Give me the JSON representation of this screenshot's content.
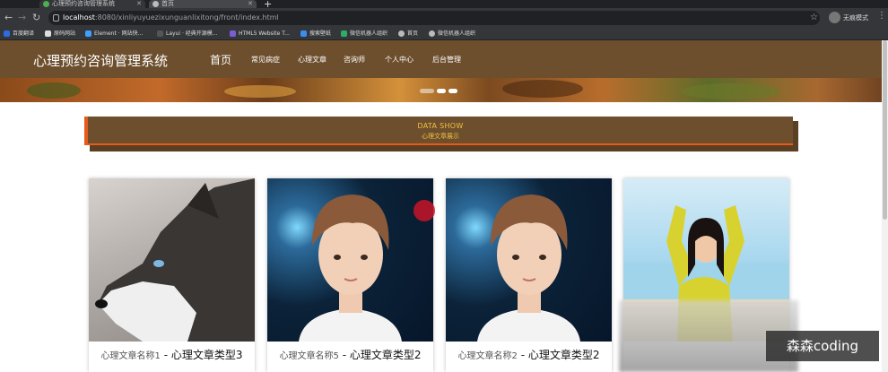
{
  "browser": {
    "tabs": [
      {
        "title": "心理预约咨询管理系统"
      },
      {
        "title": "首页"
      }
    ],
    "url_host": "localhost",
    "url_path": ":8080/xinliyuyuezixunguanlixitong/front/index.html",
    "profile_label": "无痕模式",
    "bookmarks": [
      "百度翻译",
      "原码网站",
      "Element · 网站快...",
      "Layui · 经典开源模...",
      "HTML5 Website T...",
      "搜索壁纸",
      "微信机器人组织",
      "首页",
      "微信机器人组织"
    ]
  },
  "site": {
    "title": "心理预约咨询管理系统",
    "nav": [
      "首页",
      "常见病症",
      "心理文章",
      "咨询师",
      "个人中心",
      "后台管理"
    ],
    "active_nav": "首页"
  },
  "data_show": {
    "en": "DATA SHOW",
    "cn": "心理文章展示"
  },
  "cards": [
    {
      "name": "心理文章名称1",
      "sep": " - ",
      "type": "心理文章类型3",
      "photo": "husky"
    },
    {
      "name": "心理文章名称5",
      "sep": " - ",
      "type": "心理文章类型2",
      "photo": "boy"
    },
    {
      "name": "心理文章名称2",
      "sep": " - ",
      "type": "心理文章类型2",
      "photo": "boy"
    },
    {
      "name": "",
      "sep": "",
      "type": "",
      "photo": "girl"
    }
  ],
  "watermark": "森森coding",
  "colors": {
    "header_bg": "#6d4f2e",
    "accent": "#e65a1a",
    "data_show_text": "#f0c040"
  }
}
